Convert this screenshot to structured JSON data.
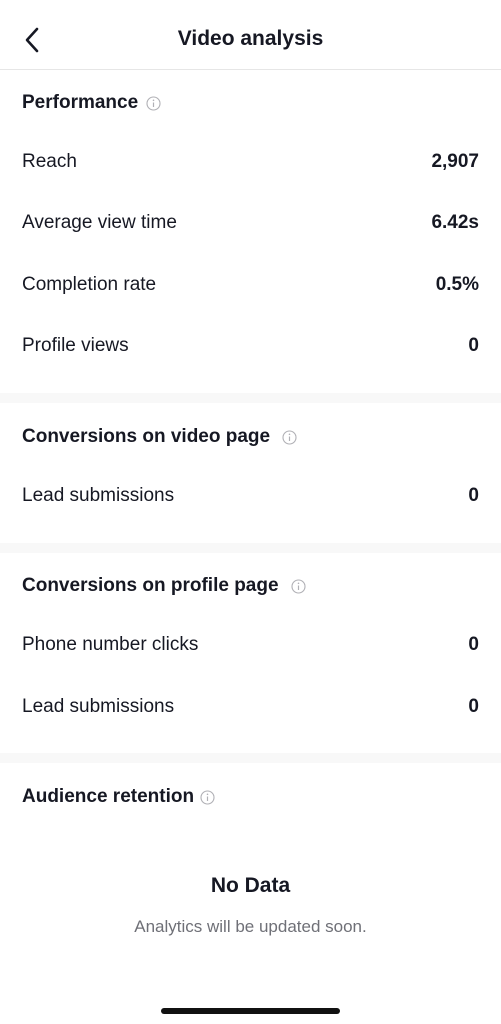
{
  "header": {
    "title": "Video analysis",
    "back_icon": "chevron-left-icon"
  },
  "performance": {
    "title": "Performance",
    "rows": [
      {
        "label": "Reach",
        "value": "2,907"
      },
      {
        "label": "Average view time",
        "value": "6.42s"
      },
      {
        "label": "Completion rate",
        "value": "0.5%"
      },
      {
        "label": "Profile views",
        "value": "0"
      }
    ]
  },
  "video_page_conversions": {
    "title": "Conversions on video page",
    "rows": [
      {
        "label": "Lead submissions",
        "value": "0"
      }
    ]
  },
  "profile_page_conversions": {
    "title": "Conversions on profile page",
    "rows": [
      {
        "label": "Phone number clicks",
        "value": "0"
      },
      {
        "label": "Lead submissions",
        "value": "0"
      }
    ]
  },
  "audience_retention": {
    "title": "Audience retention",
    "empty_title": "No Data",
    "empty_subtitle": "Analytics will be updated soon."
  },
  "colors": {
    "text_primary": "#161823",
    "text_secondary": "#6f7077",
    "divider": "#f8f8f8",
    "info_icon": "#b0b0b5"
  }
}
